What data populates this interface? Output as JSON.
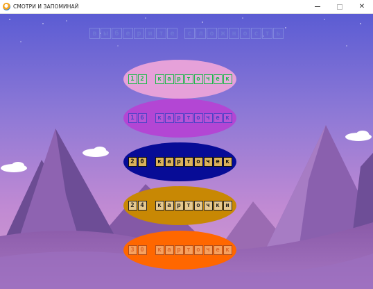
{
  "window": {
    "title": "СМОТРИ И ЗАПОМИНАЙ",
    "icon": "app-logo-icon",
    "controls": {
      "minimize": "minimize-icon",
      "maximize": "maximize-icon",
      "close": "✕"
    }
  },
  "heading": {
    "words": [
      "выберите",
      "сложность"
    ]
  },
  "options": [
    {
      "count": "12",
      "word": "карточек"
    },
    {
      "count": "16",
      "word": "карточек"
    },
    {
      "count": "20",
      "word": "карточек"
    },
    {
      "count": "24",
      "word": "карточки"
    },
    {
      "count": "30",
      "word": "карточек"
    }
  ],
  "colors": {
    "sky_top": "#5f5fd6",
    "sky_bottom": "#c48ad2",
    "option_12": "#e6a1d9",
    "option_16": "#b346d4",
    "option_20": "#070c96",
    "option_24": "#c88804",
    "option_30": "#ff6700"
  }
}
